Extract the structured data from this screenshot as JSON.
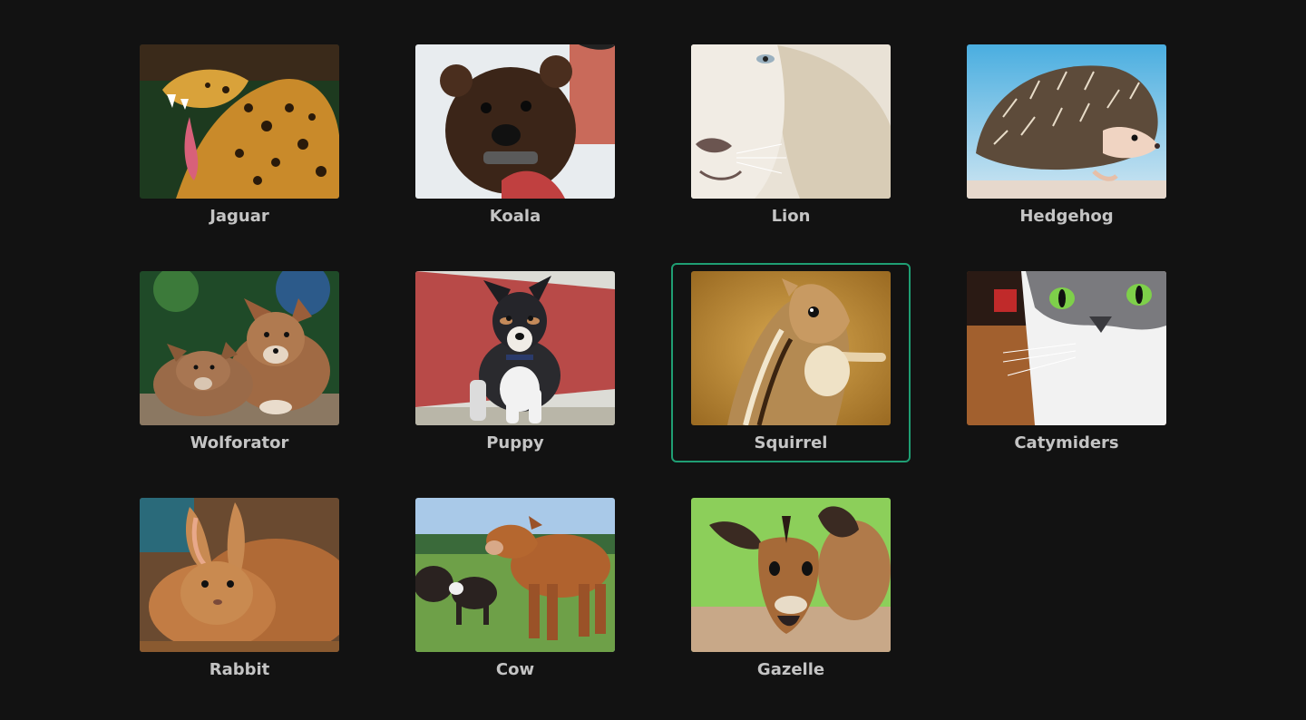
{
  "gallery": {
    "selected_index": 6,
    "accent_color": "#1f9e73",
    "items": [
      {
        "label": "Jaguar",
        "icon": "jaguar-image"
      },
      {
        "label": "Koala",
        "icon": "koala-image"
      },
      {
        "label": "Lion",
        "icon": "lion-image"
      },
      {
        "label": "Hedgehog",
        "icon": "hedgehog-image"
      },
      {
        "label": "Wolforator",
        "icon": "wolf-pups-image"
      },
      {
        "label": "Puppy",
        "icon": "puppy-image"
      },
      {
        "label": "Squirrel",
        "icon": "squirrel-image"
      },
      {
        "label": "Catymiders",
        "icon": "cat-image"
      },
      {
        "label": "Rabbit",
        "icon": "rabbit-image"
      },
      {
        "label": "Cow",
        "icon": "cow-image"
      },
      {
        "label": "Gazelle",
        "icon": "gazelle-image"
      }
    ]
  }
}
